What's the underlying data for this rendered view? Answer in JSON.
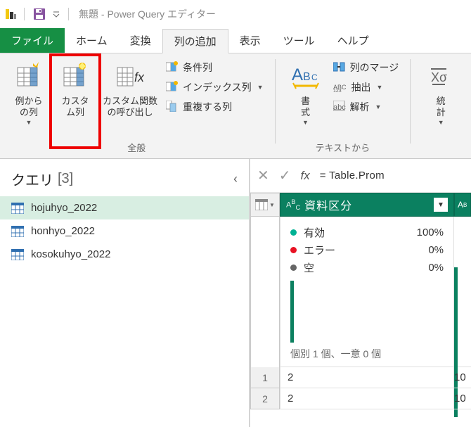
{
  "title": "無題 - Power Query エディター",
  "tabs": {
    "file": "ファイル",
    "home": "ホーム",
    "transform": "変換",
    "addcol": "列の追加",
    "view": "表示",
    "tools": "ツール",
    "help": "ヘルプ"
  },
  "ribbon": {
    "group_general": "全般",
    "group_textfrom": "テキストから",
    "from_examples": "例から\nの列",
    "custom_column": "カスタ\nム列",
    "invoke_fn": "カスタム関数\nの呼び出し",
    "conditional": "条件列",
    "index": "インデックス列",
    "duplicate": "重複する列",
    "format": "書\n式",
    "merge_cols": "列のマージ",
    "extract": "抽出",
    "parse": "解析",
    "stats": "統\n計"
  },
  "query_pane": {
    "title": "クエリ",
    "count": "[3]",
    "items": [
      {
        "name": "hojuhyo_2022",
        "selected": true
      },
      {
        "name": "honhyo_2022",
        "selected": false
      },
      {
        "name": "kosokuhyo_2022",
        "selected": false
      }
    ]
  },
  "formula": {
    "fx": "fx",
    "text": "= Table.Prom"
  },
  "grid": {
    "column1": "資料区分",
    "profile": {
      "valid_label": "有効",
      "valid_pct": "100%",
      "valid_color": "#00b294",
      "error_label": "エラー",
      "error_pct": "0%",
      "error_color": "#e81123",
      "empty_label": "空",
      "empty_pct": "0%",
      "empty_color": "#666666",
      "meta": "個別 1 個、一意 0 個"
    },
    "rows": [
      {
        "n": "1",
        "v": "2",
        "vx": "10"
      },
      {
        "n": "2",
        "v": "2",
        "vx": "10"
      }
    ]
  }
}
